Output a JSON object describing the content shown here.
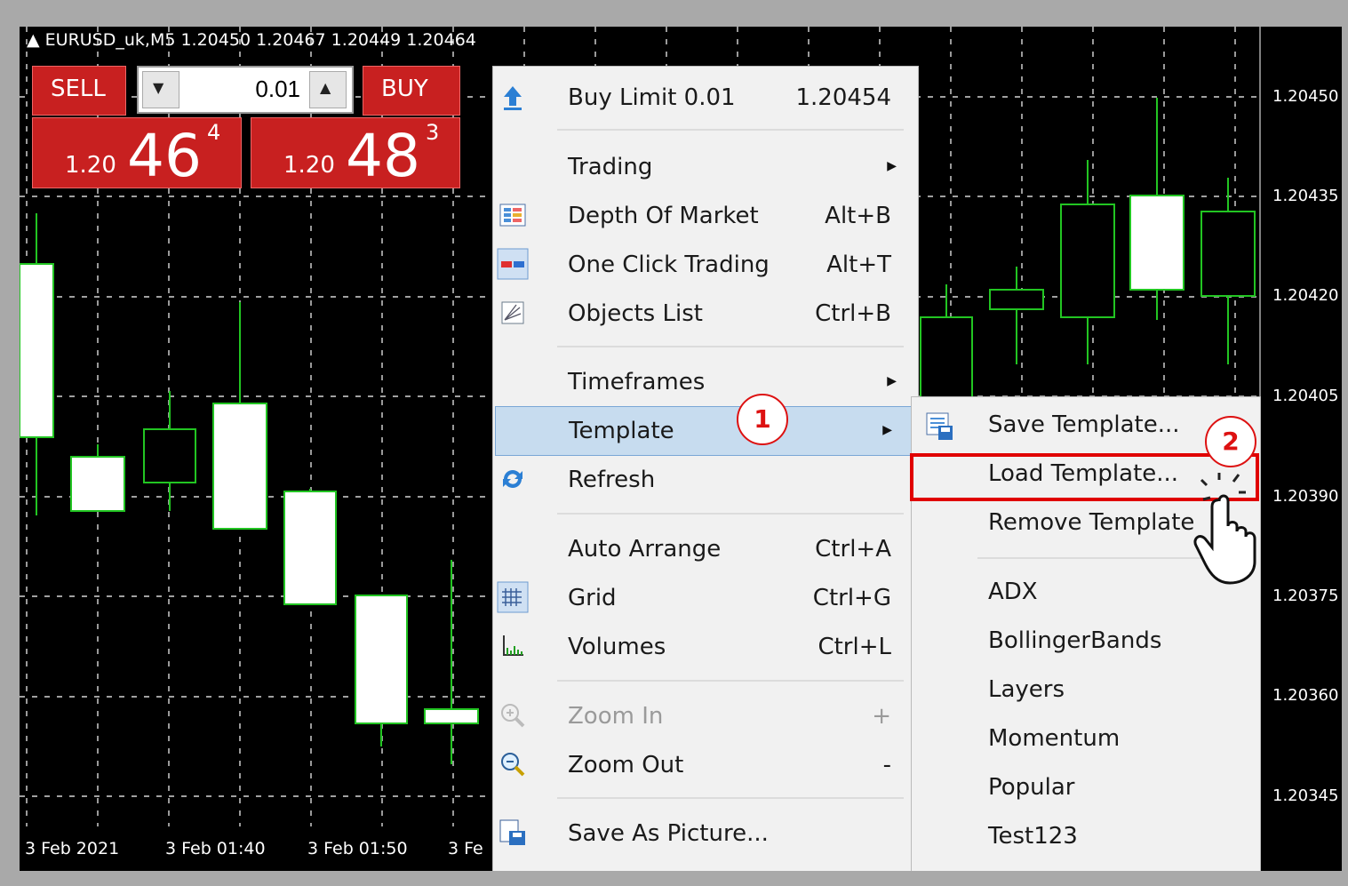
{
  "chart": {
    "symbol_line": "▲ EURUSD_uk,M5  1.20450 1.20467 1.20449 1.20464",
    "y_labels": [
      "1.20450",
      "1.20435",
      "1.20420",
      "1.20405",
      "1.20390",
      "1.20375",
      "1.20360",
      "1.20345"
    ],
    "x_labels": [
      "3 Feb 2021",
      "3 Feb 01:40",
      "3 Feb 01:50",
      "3 Fe"
    ],
    "colors": {
      "background": "#000000",
      "candle": "#22c522",
      "grid": "#ffffff"
    }
  },
  "trade_panel": {
    "sell_label": "SELL",
    "buy_label": "BUY",
    "lot_value": "0.01",
    "sell_price_small": "1.20",
    "sell_price_big": "46",
    "sell_price_sup": "4",
    "buy_price_small": "1.20",
    "buy_price_big": "48",
    "buy_price_sup": "3",
    "accent": "#c82020"
  },
  "context_menu": {
    "items": [
      {
        "label": "Buy Limit 0.01",
        "shortcut": "1.20454",
        "icon": "buy-limit-arrow-icon"
      },
      {
        "label": "Trading",
        "submenu": true
      },
      {
        "label": "Depth Of Market",
        "shortcut": "Alt+B",
        "icon": "depth-of-market-icon"
      },
      {
        "label": "One Click Trading",
        "shortcut": "Alt+T",
        "icon": "one-click-trading-icon"
      },
      {
        "label": "Objects List",
        "shortcut": "Ctrl+B",
        "icon": "objects-list-icon"
      },
      {
        "label": "Timeframes",
        "submenu": true
      },
      {
        "label": "Template",
        "submenu": true,
        "highlighted": true
      },
      {
        "label": "Refresh",
        "icon": "refresh-icon"
      },
      {
        "label": "Auto Arrange",
        "shortcut": "Ctrl+A"
      },
      {
        "label": "Grid",
        "shortcut": "Ctrl+G",
        "icon": "grid-icon"
      },
      {
        "label": "Volumes",
        "shortcut": "Ctrl+L",
        "icon": "volumes-icon"
      },
      {
        "label": "Zoom In",
        "shortcut": "+",
        "icon": "zoom-in-icon",
        "disabled": true
      },
      {
        "label": "Zoom Out",
        "shortcut": "-",
        "icon": "zoom-out-icon"
      },
      {
        "label": "Save As Picture...",
        "icon": "save-picture-icon"
      }
    ]
  },
  "template_submenu": {
    "items": [
      {
        "label": "Save Template...",
        "icon": "save-template-icon"
      },
      {
        "label": "Load Template...",
        "highlighted": true
      },
      {
        "label": "Remove Template"
      },
      {
        "label": "ADX"
      },
      {
        "label": "BollingerBands"
      },
      {
        "label": "Layers"
      },
      {
        "label": "Momentum"
      },
      {
        "label": "Popular"
      },
      {
        "label": "Test123"
      }
    ]
  },
  "annotations": {
    "step1": "1",
    "step2": "2",
    "highlight_color": "#e00000"
  }
}
